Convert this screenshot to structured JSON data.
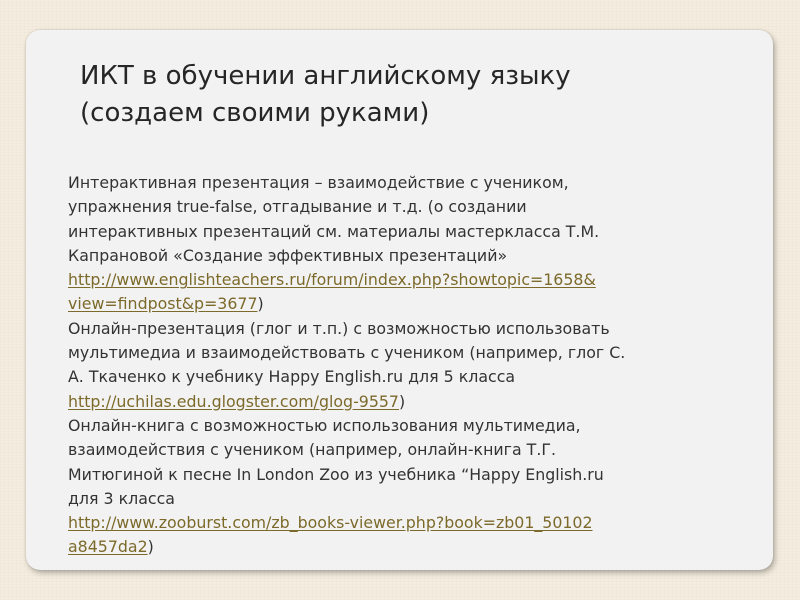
{
  "slide": {
    "title_lines": [
      "ИКТ в обучении английскому языку",
      "(создаем своими руками)"
    ],
    "body": {
      "l1": "Интерактивная презентация – взаимодействие с учеником,",
      "l2": "упражнения true-false, отгадывание и т.д. (о создании",
      "l3": "интерактивных презентаций см. материалы мастеркласса Т.М.",
      "l4": "Капрановой «Создание эффективных презентаций»",
      "link1_line1": "http://www.englishteachers.ru/forum/index.php?showtopic=1658&",
      "link1_line2": "view=findpost&p=3677",
      "close_paren": ")",
      "l7": "Онлайн-презентация (глог и т.п.) с возможностью использовать",
      "l8": "мультимедиа и взаимодействовать с учеником (например, глог С.",
      "l9": "А. Ткаченко к учебнику Happy English.ru для 5 класса",
      "link2": "http://uchilas.edu.glogster.com/glog-9557",
      "l11": "Онлайн-книга с возможностью использования мультимедиа,",
      "l12": "взаимодействия с учеником (например, онлайн-книга Т.Г.",
      "l13": "Митюгиной к песне In London Zoo из учебника “Happy English.ru",
      "l14": "для 3 класса",
      "link3_line1": "http://www.zooburst.com/zb_books-viewer.php?book=zb01_50102",
      "link3_line2": "a8457da2"
    }
  },
  "colors": {
    "background": "#f4eddf",
    "card": "#f2f2f2",
    "title_text": "#262626",
    "body_text": "#333333",
    "link": "#7c6a2a"
  }
}
